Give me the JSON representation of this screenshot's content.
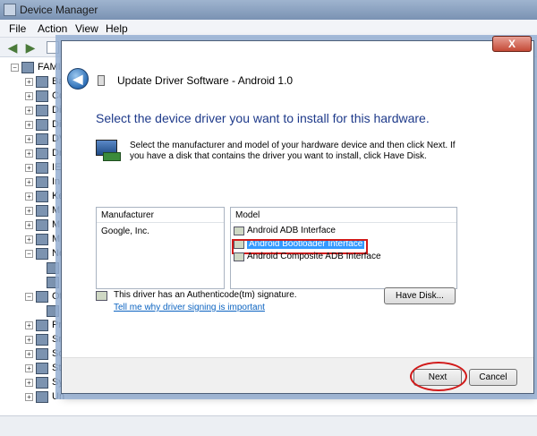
{
  "device_manager": {
    "title": "Device Manager",
    "menu": [
      "File",
      "Action",
      "View",
      "Help"
    ],
    "root_label": "FAMI",
    "tree_items": [
      "Ba",
      "Co",
      "Di",
      "Di",
      "DV",
      "Dr",
      "IE",
      "In",
      "Ke",
      "M",
      "M",
      "M",
      "Ne",
      "",
      "",
      "Ot",
      "",
      "Pr",
      "Sn",
      "So",
      "St",
      "Sy",
      "Un"
    ]
  },
  "dialog": {
    "close_label": "X",
    "title": "Update Driver Software - Android 1.0",
    "instruction": "Select the device driver you want to install for this hardware.",
    "description": "Select the manufacturer and model of your hardware device and then click Next. If you have a disk that contains the driver you want to install, click Have Disk.",
    "manufacturer": {
      "header": "Manufacturer",
      "items": [
        "Google, Inc."
      ]
    },
    "model": {
      "header": "Model",
      "items": [
        "Android ADB Interface",
        "Android Bootloader Interface",
        "Android Composite ADB Interface"
      ],
      "selected": "Android Bootloader Interface"
    },
    "signature_text": "This driver has an Authenticode(tm) signature.",
    "signature_link": "Tell me why driver signing is important",
    "have_disk_label": "Have Disk...",
    "next_label": "Next",
    "cancel_label": "Cancel"
  },
  "colors": {
    "instruction_text": "#1e3a8a",
    "selection": "#3399ff",
    "highlight_annotation": "#d11a1a",
    "link": "#0b63c1"
  }
}
